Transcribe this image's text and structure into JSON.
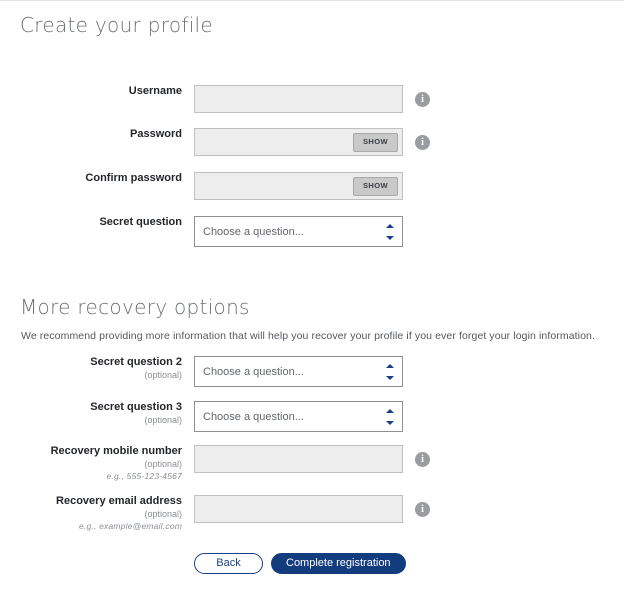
{
  "sections": {
    "create": {
      "title": "Create your profile"
    },
    "recovery": {
      "title": "More recovery options",
      "description": "We recommend providing more information that will help you recover your profile if you ever forget your login information."
    }
  },
  "fields": {
    "username": {
      "label": "Username",
      "value": "",
      "placeholder": ""
    },
    "password": {
      "label": "Password",
      "value": "",
      "placeholder": "",
      "show_label": "SHOW"
    },
    "confirm_password": {
      "label": "Confirm password",
      "value": "",
      "placeholder": "",
      "show_label": "SHOW"
    },
    "secret_question": {
      "label": "Secret question",
      "selected": "Choose a question..."
    },
    "secret_question_2": {
      "label": "Secret question 2",
      "optional": "(optional)",
      "selected": "Choose a question..."
    },
    "secret_question_3": {
      "label": "Secret question 3",
      "optional": "(optional)",
      "selected": "Choose a question..."
    },
    "recovery_mobile": {
      "label": "Recovery mobile number",
      "optional": "(optional)",
      "hint": "e.g., 555-123-4567",
      "value": "",
      "placeholder": ""
    },
    "recovery_email": {
      "label": "Recovery email address",
      "optional": "(optional)",
      "hint": "e.g., example@email.com",
      "value": "",
      "placeholder": ""
    }
  },
  "icons": {
    "info": "i"
  },
  "buttons": {
    "back": "Back",
    "complete": "Complete registration"
  },
  "colors": {
    "primary": "#123c7e",
    "accent": "#1b3e8c",
    "input_fill": "#ededed",
    "heading": "#6c6f76"
  }
}
